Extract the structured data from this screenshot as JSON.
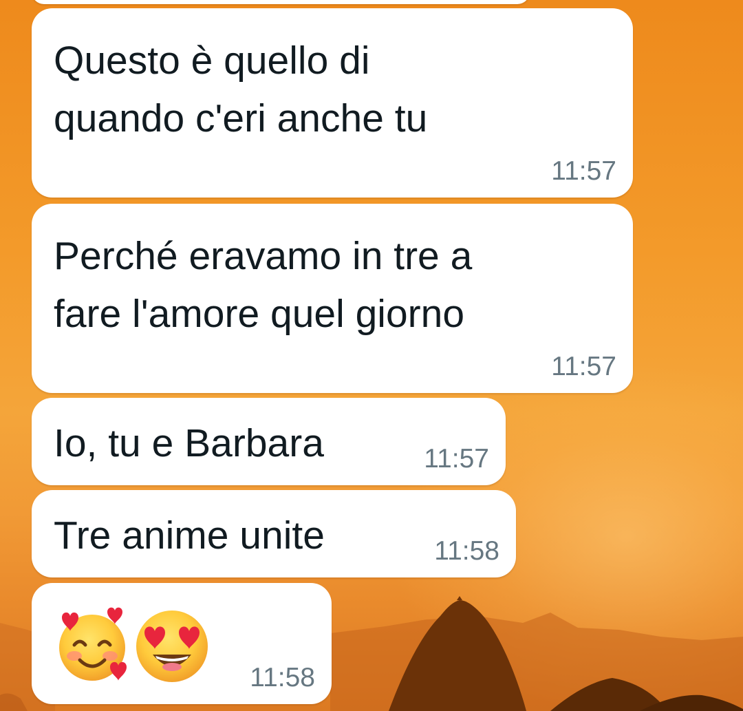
{
  "chat": {
    "messages": [
      {
        "text": "Questo è quello di\nquando c'eri anche tu",
        "time": "11:57"
      },
      {
        "text": "Perché eravamo in tre a\nfare l'amore quel giorno",
        "time": "11:57"
      },
      {
        "text": "Io, tu e Barbara",
        "time": "11:57"
      },
      {
        "text": "Tre anime unite",
        "time": "11:58"
      },
      {
        "emojis": [
          "smiling-face-with-hearts-icon",
          "heart-eyes-icon"
        ],
        "time": "11:58"
      }
    ]
  },
  "colors": {
    "bubble": "#ffffff",
    "text": "#111b21",
    "timestamp": "#667781",
    "wallpaper": "#f39a2a"
  }
}
